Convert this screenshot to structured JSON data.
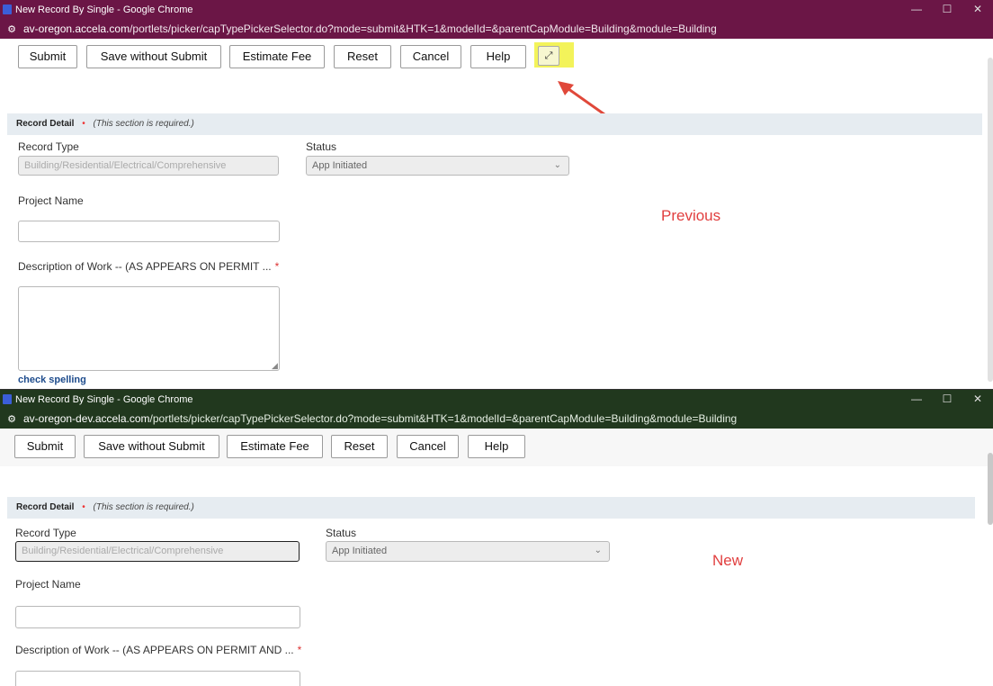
{
  "previous": {
    "window_title": "New Record By Single - Google Chrome",
    "url_host": "av-oregon.accela.com",
    "url_path": "/portlets/picker/capTypePickerSelector.do?mode=submit&HTK=1&modelId=&parentCapModule=Building&module=Building",
    "toolbar": {
      "submit": "Submit",
      "save_without_submit": "Save without Submit",
      "estimate_fee": "Estimate Fee",
      "reset": "Reset",
      "cancel": "Cancel",
      "help": "Help",
      "expand_icon": "expand-arrows-icon"
    },
    "section": {
      "title": "Record Detail",
      "note": "(This section is required.)"
    },
    "fields": {
      "record_type_label": "Record Type",
      "record_type_value": "Building/Residential/Electrical/Comprehensive",
      "status_label": "Status",
      "status_value": "App Initiated",
      "project_name_label": "Project Name",
      "description_label": "Description of Work -- (AS APPEARS ON PERMIT ...",
      "check_spelling": "check spelling"
    },
    "annotation": "Previous",
    "highlight_color": "#f3f35a",
    "arrow_color": "#e0483a"
  },
  "new": {
    "window_title": "New Record By Single - Google Chrome",
    "url_host": "av-oregon-dev.accela.com",
    "url_path": "/portlets/picker/capTypePickerSelector.do?mode=submit&HTK=1&modelId=&parentCapModule=Building&module=Building",
    "toolbar": {
      "submit": "Submit",
      "save_without_submit": "Save without Submit",
      "estimate_fee": "Estimate Fee",
      "reset": "Reset",
      "cancel": "Cancel",
      "help": "Help"
    },
    "section": {
      "title": "Record Detail",
      "note": "(This section is required.)"
    },
    "fields": {
      "record_type_label": "Record Type",
      "record_type_value": "Building/Residential/Electrical/Comprehensive",
      "status_label": "Status",
      "status_value": "App Initiated",
      "project_name_label": "Project Name",
      "description_label": "Description of Work -- (AS APPEARS ON PERMIT AND ..."
    },
    "annotation": "New"
  }
}
